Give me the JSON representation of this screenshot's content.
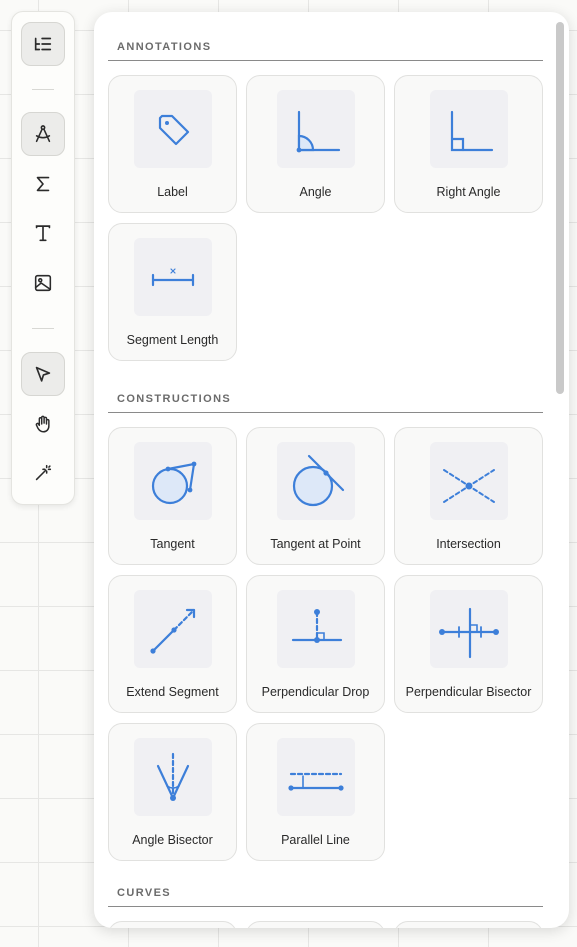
{
  "toolbar": {
    "items": [
      {
        "icon": "outline-list-icon",
        "active": true
      },
      {
        "icon": "compass-tool-icon",
        "active": true
      },
      {
        "icon": "sigma-icon",
        "active": false
      },
      {
        "icon": "text-icon",
        "active": false
      },
      {
        "icon": "image-icon",
        "active": false
      },
      {
        "icon": "pointer-icon",
        "active": true
      },
      {
        "icon": "hand-icon",
        "active": false
      },
      {
        "icon": "magic-wand-icon",
        "active": false
      }
    ]
  },
  "panel": {
    "sections": [
      {
        "title": "ANNOTATIONS",
        "tools": [
          {
            "label": "Label",
            "icon": "label-tag-icon"
          },
          {
            "label": "Angle",
            "icon": "angle-icon"
          },
          {
            "label": "Right Angle",
            "icon": "right-angle-icon"
          },
          {
            "label": "Segment Length",
            "icon": "segment-length-icon"
          }
        ]
      },
      {
        "title": "CONSTRUCTIONS",
        "tools": [
          {
            "label": "Tangent",
            "icon": "tangent-icon"
          },
          {
            "label": "Tangent at Point",
            "icon": "tangent-at-point-icon"
          },
          {
            "label": "Intersection",
            "icon": "intersection-icon"
          },
          {
            "label": "Extend Segment",
            "icon": "extend-segment-icon"
          },
          {
            "label": "Perpendicular Drop",
            "icon": "perpendicular-drop-icon"
          },
          {
            "label": "Perpendicular Bisector",
            "icon": "perpendicular-bisector-icon"
          },
          {
            "label": "Angle Bisector",
            "icon": "angle-bisector-icon"
          },
          {
            "label": "Parallel Line",
            "icon": "parallel-line-icon"
          }
        ]
      },
      {
        "title": "CURVES",
        "tools": []
      }
    ]
  },
  "colors": {
    "accent": "#3d7fd9",
    "accent_fill": "#dde8f8"
  }
}
